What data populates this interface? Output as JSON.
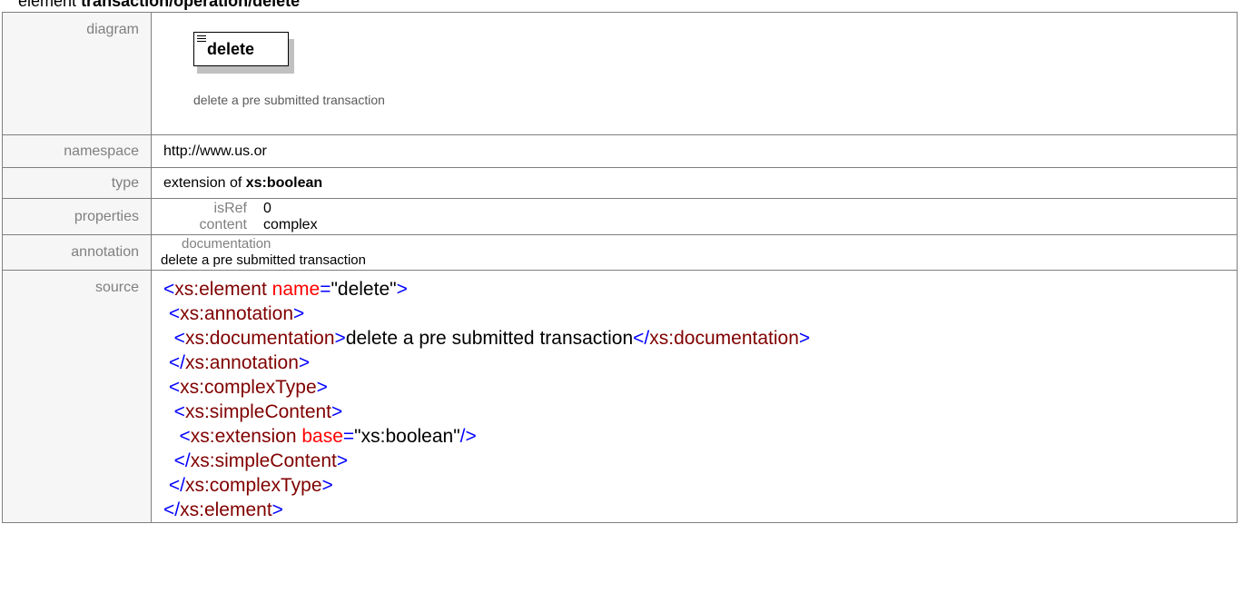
{
  "heading": {
    "prefix": "element",
    "name": "transaction/operation/delete"
  },
  "rows": {
    "diagram": {
      "label": "diagram",
      "box_label": "delete",
      "caption": "delete a pre submitted transaction"
    },
    "namespace": {
      "label": "namespace",
      "value": "http://www.us.or"
    },
    "type": {
      "label": "type",
      "prefix": "extension of",
      "base": "xs:boolean"
    },
    "properties": {
      "label": "properties",
      "items": [
        {
          "key": "isRef",
          "value": "0"
        },
        {
          "key": "content",
          "value": "complex"
        }
      ]
    },
    "annotation": {
      "label": "annotation",
      "key": "documentation",
      "value": "delete a pre submitted transaction"
    },
    "source": {
      "label": "source",
      "lines": [
        [
          [
            "t",
            "<"
          ],
          [
            "n",
            "xs:element"
          ],
          [
            "x",
            " "
          ],
          [
            "a",
            "name"
          ],
          [
            "t",
            "="
          ],
          [
            "x",
            "\"delete\""
          ],
          [
            "t",
            ">"
          ]
        ],
        [
          [
            "x",
            " "
          ],
          [
            "t",
            "<"
          ],
          [
            "n",
            "xs:annotation"
          ],
          [
            "t",
            ">"
          ]
        ],
        [
          [
            "x",
            "  "
          ],
          [
            "t",
            "<"
          ],
          [
            "n",
            "xs:documentation"
          ],
          [
            "t",
            ">"
          ],
          [
            "x",
            "delete a pre submitted transaction"
          ],
          [
            "t",
            "</"
          ],
          [
            "n",
            "xs:documentation"
          ],
          [
            "t",
            ">"
          ]
        ],
        [
          [
            "x",
            " "
          ],
          [
            "t",
            "</"
          ],
          [
            "n",
            "xs:annotation"
          ],
          [
            "t",
            ">"
          ]
        ],
        [
          [
            "x",
            " "
          ],
          [
            "t",
            "<"
          ],
          [
            "n",
            "xs:complexType"
          ],
          [
            "t",
            ">"
          ]
        ],
        [
          [
            "x",
            "  "
          ],
          [
            "t",
            "<"
          ],
          [
            "n",
            "xs:simpleContent"
          ],
          [
            "t",
            ">"
          ]
        ],
        [
          [
            "x",
            "   "
          ],
          [
            "t",
            "<"
          ],
          [
            "n",
            "xs:extension"
          ],
          [
            "x",
            " "
          ],
          [
            "a",
            "base"
          ],
          [
            "t",
            "="
          ],
          [
            "x",
            "\"xs:boolean\""
          ],
          [
            "t",
            "/>"
          ]
        ],
        [
          [
            "x",
            "  "
          ],
          [
            "t",
            "</"
          ],
          [
            "n",
            "xs:simpleContent"
          ],
          [
            "t",
            ">"
          ]
        ],
        [
          [
            "x",
            " "
          ],
          [
            "t",
            "</"
          ],
          [
            "n",
            "xs:complexType"
          ],
          [
            "t",
            ">"
          ]
        ],
        [
          [
            "t",
            "</"
          ],
          [
            "n",
            "xs:element"
          ],
          [
            "t",
            ">"
          ]
        ]
      ]
    }
  }
}
